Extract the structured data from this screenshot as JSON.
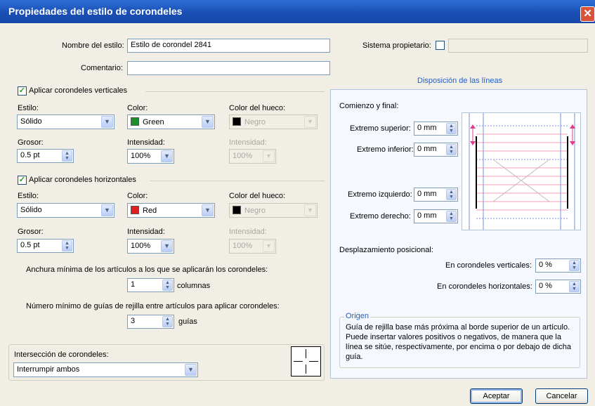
{
  "window": {
    "title": "Propiedades del estilo de corondeles",
    "close_glyph": "✕"
  },
  "style_name": {
    "label": "Nombre del estilo:",
    "value": "Estilo de corondel 2841"
  },
  "comment": {
    "label": "Comentario:",
    "value": ""
  },
  "system_owner": {
    "label": "Sistema propietario:",
    "value": ""
  },
  "vertical": {
    "checkbox_label": "Aplicar corondeles verticales",
    "checked": true,
    "style_label": "Estilo:",
    "style_value": "Sólido",
    "color_label": "Color:",
    "color_value": "Green",
    "color_swatch": "#1e8f2a",
    "gap_color_label": "Color del hueco:",
    "gap_color_value": "Negro",
    "gap_swatch": "#000000",
    "weight_label": "Grosor:",
    "weight_value": "0.5 pt",
    "intensity_label": "Intensidad:",
    "intensity_value": "100%",
    "gap_intensity_label": "Intensidad:",
    "gap_intensity_value": "100%"
  },
  "horizontal": {
    "checkbox_label": "Aplicar corondeles horizontales",
    "checked": true,
    "style_label": "Estilo:",
    "style_value": "Sólido",
    "color_label": "Color:",
    "color_value": "Red",
    "color_swatch": "#e02020",
    "gap_color_label": "Color del hueco:",
    "gap_color_value": "Negro",
    "gap_swatch": "#000000",
    "weight_label": "Grosor:",
    "weight_value": "0.5 pt",
    "intensity_label": "Intensidad:",
    "intensity_value": "100%",
    "gap_intensity_label": "Intensidad:",
    "gap_intensity_value": "100%"
  },
  "min_width": {
    "label": "Anchura mínima de los artículos a los que se aplicarán los corondeles:",
    "value": "1",
    "unit": "columnas"
  },
  "min_guides": {
    "label": "Número mínimo de guías de rejilla entre artículos para aplicar corondeles:",
    "value": "3",
    "unit": "guías"
  },
  "intersection": {
    "label": "Intersección de corondeles:",
    "value": "Interrumpir ambos"
  },
  "layout": {
    "title": "Disposición de las líneas",
    "start_end_label": "Comienzo y final:",
    "top_end_label": "Extremo superior:",
    "top_end_value": "0 mm",
    "bottom_end_label": "Extremo inferior:",
    "bottom_end_value": "0 mm",
    "left_end_label": "Extremo izquierdo:",
    "left_end_value": "0 mm",
    "right_end_label": "Extremo derecho:",
    "right_end_value": "0 mm",
    "offset_label": "Desplazamiento posicional:",
    "vertical_offset_label": "En corondeles verticales:",
    "vertical_offset_value": "0 %",
    "horizontal_offset_label": "En corondeles horizontales:",
    "horizontal_offset_value": "0 %",
    "origin_title": "Origen",
    "origin_text": "Guía de rejilla base más próxima al borde superior de un artículo. Puede insertar valores positivos o negativos, de manera que la línea se sitúe, respectivamente, por encima o por debajo de dicha guía."
  },
  "buttons": {
    "ok": "Aceptar",
    "cancel": "Cancelar"
  }
}
